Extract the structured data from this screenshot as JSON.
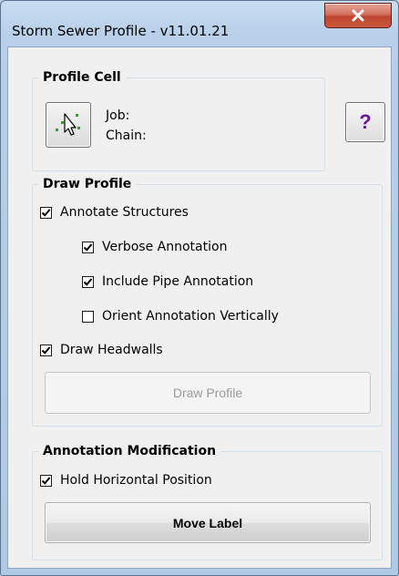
{
  "window": {
    "title": "Storm Sewer Profile - v11.01.21",
    "close_label": "x"
  },
  "profile_cell": {
    "title": "Profile Cell",
    "job_label": "Job:",
    "chain_label": "Chain:",
    "pick_icon": "select-cell-cursor-icon"
  },
  "help_button": {
    "label": "?"
  },
  "draw_profile": {
    "title": "Draw Profile",
    "annotate_structures": {
      "label": "Annotate Structures",
      "checked": true
    },
    "verbose_annotation": {
      "label": "Verbose Annotation",
      "checked": true
    },
    "include_pipe_annotation": {
      "label": "Include Pipe Annotation",
      "checked": true
    },
    "orient_annotation_vertically": {
      "label": "Orient Annotation Vertically",
      "checked": false
    },
    "draw_headwalls": {
      "label": "Draw Headwalls",
      "checked": true
    },
    "button_label": "Draw Profile"
  },
  "annotation_modification": {
    "title": "Annotation Modification",
    "hold_horizontal_position": {
      "label": "Hold Horizontal Position",
      "checked": true
    },
    "button_label": "Move Label"
  },
  "colors": {
    "titlebar": "#b9d1ea",
    "close_button": "#c7503b",
    "dialog_background": "#f0f0f0",
    "help_question_mark": "#6a1b9a"
  }
}
